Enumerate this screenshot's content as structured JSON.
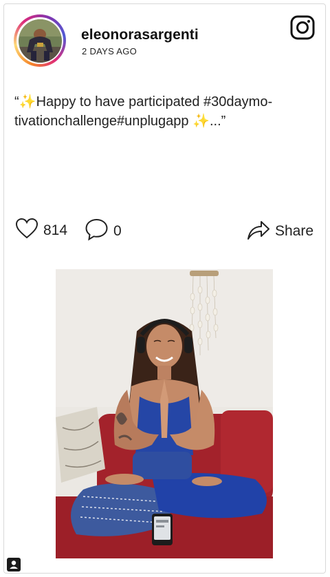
{
  "post": {
    "username": "eleonorasargenti",
    "timestamp": "2 DAYS AGO",
    "caption": "“✨Happy to have participated #30daymo-\ntivationchallenge#unplugapp ✨...”",
    "likes": "814",
    "comments": "0",
    "share_label": "Share"
  },
  "icons": {
    "platform": "instagram-icon",
    "like": "heart-icon",
    "comment": "speech-bubble-icon",
    "share": "share-arrow-icon",
    "badge": "user-tag-icon"
  },
  "colors": {
    "ring_gradient": [
      "#f58529",
      "#feda77",
      "#dd2a7b",
      "#8134af",
      "#515bd4"
    ],
    "text": "#222222",
    "border": "#d8d8d8"
  }
}
